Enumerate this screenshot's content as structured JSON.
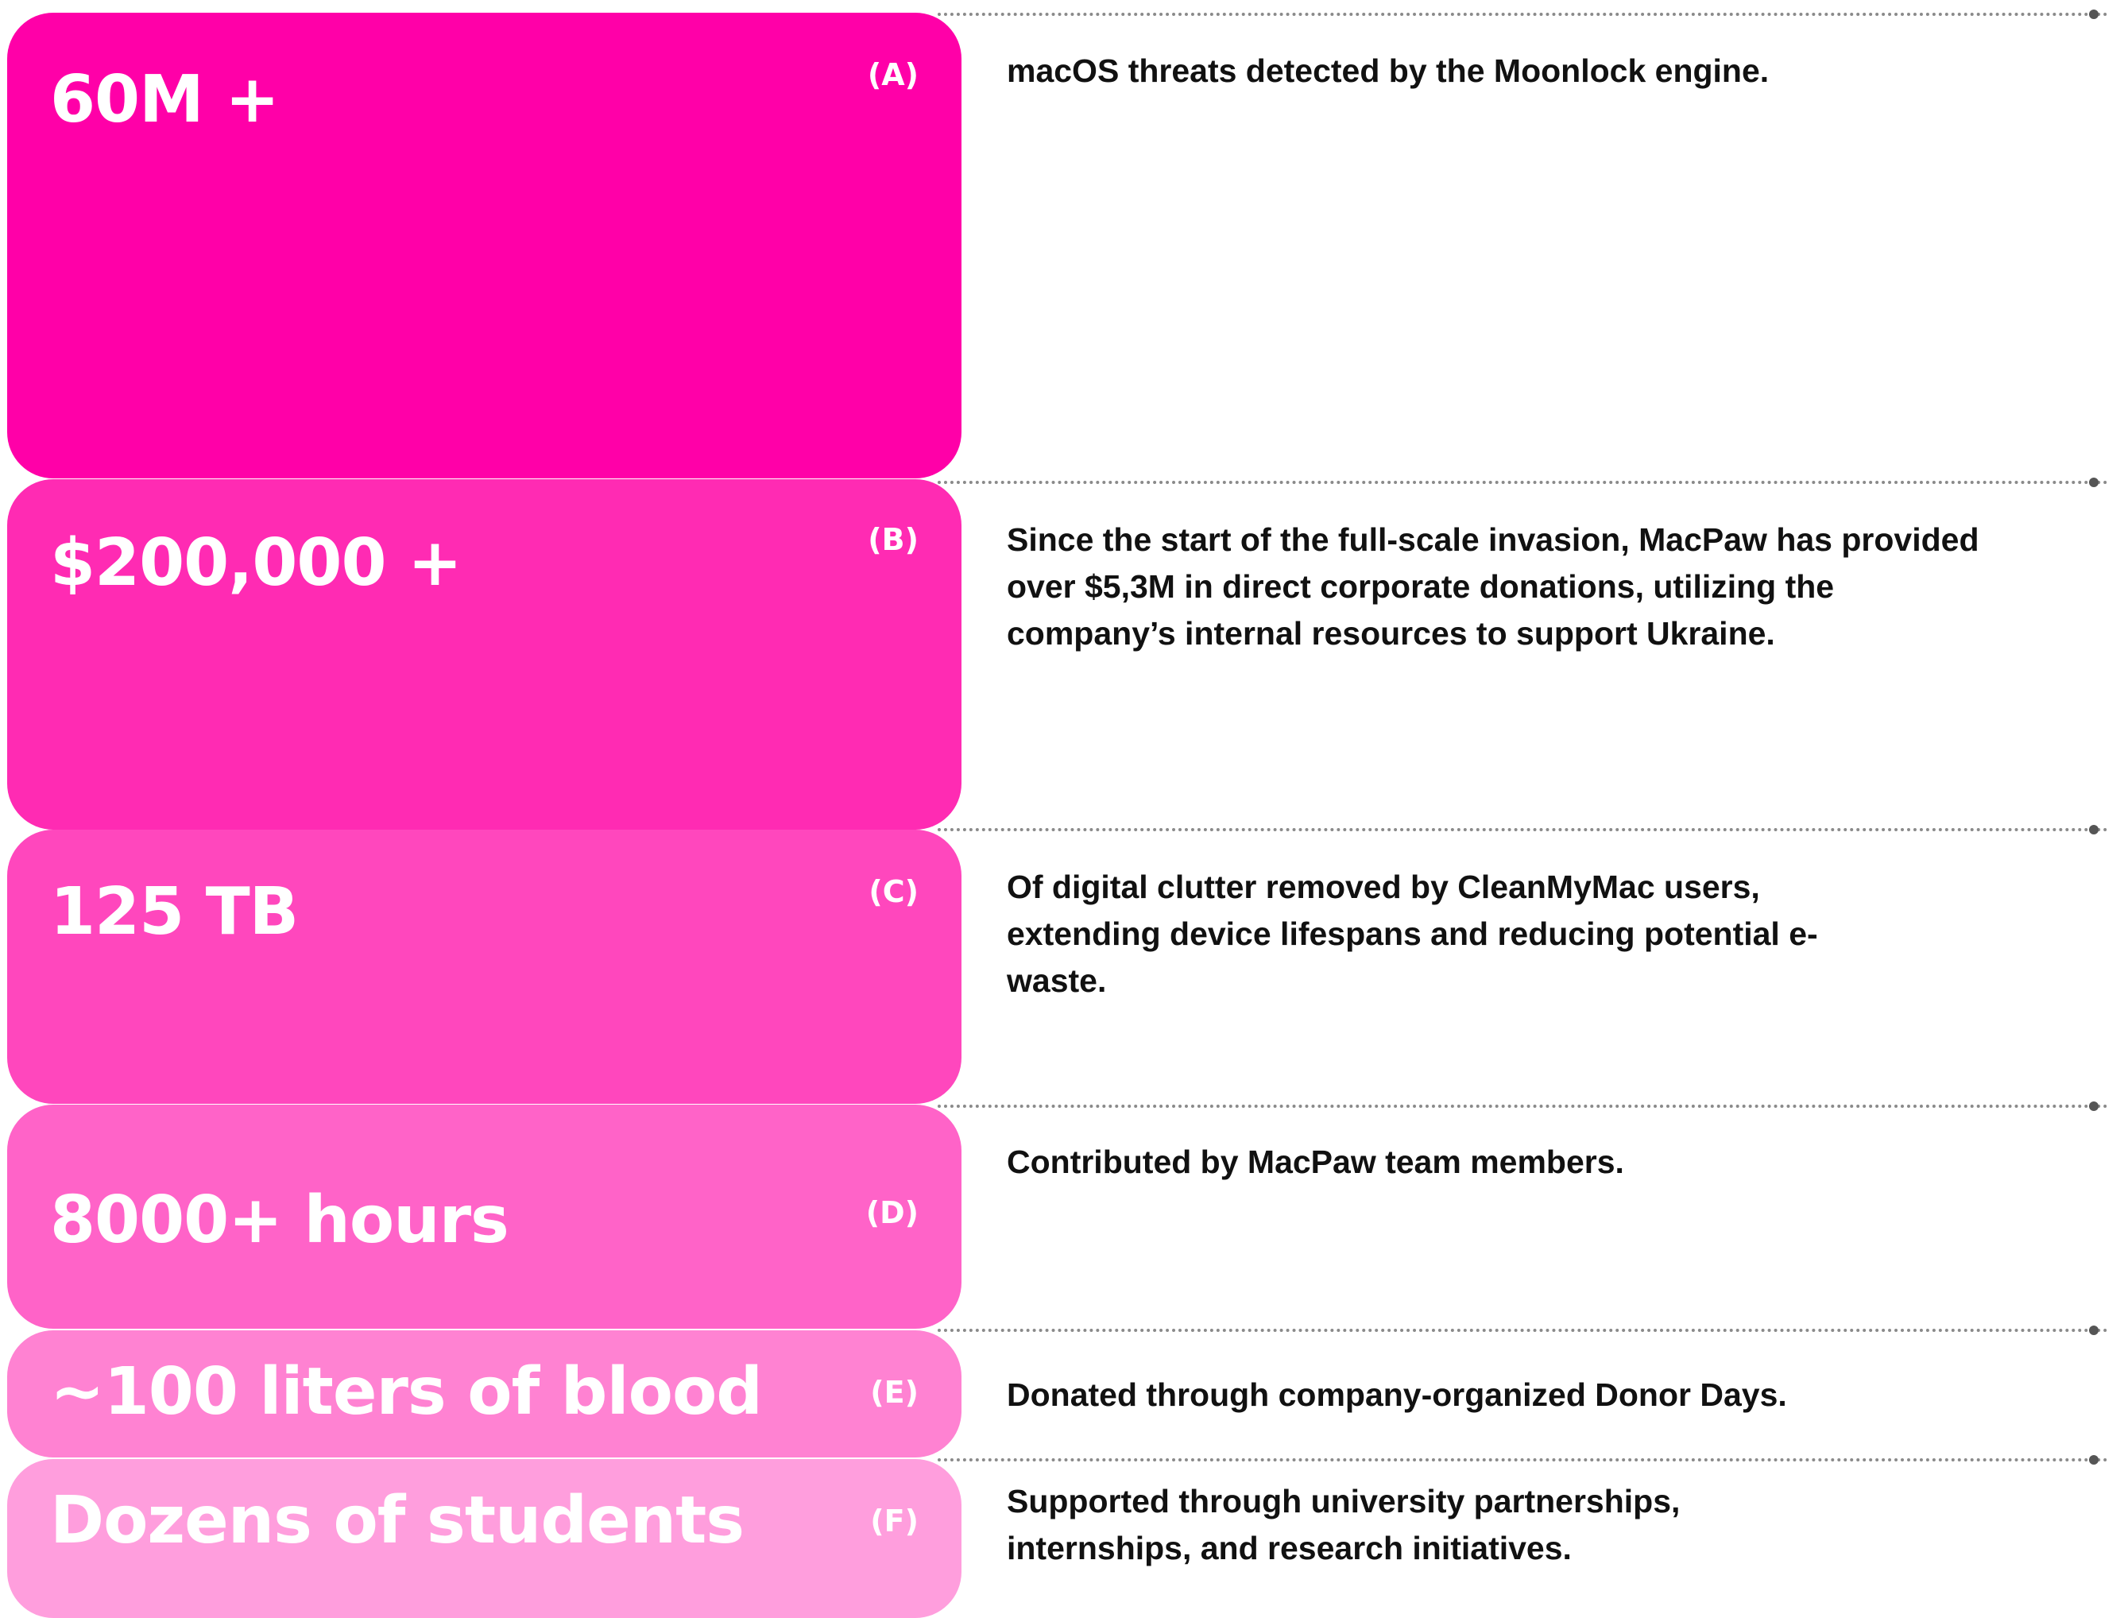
{
  "stats": [
    {
      "value": "60M +",
      "letter": "(A)",
      "description": "macOS threats detected by the Moonlock engine.",
      "color": "#ff00a8"
    },
    {
      "value": "$200,000 +",
      "letter": "(B)",
      "description": "Since the start of the full-scale invasion, MacPaw has provided over $5,3M in direct corporate donations, utilizing the company’s internal resources to support Ukraine.",
      "color": "#ff2bb3"
    },
    {
      "value": "125 TB",
      "letter": "(C)",
      "description": "Of digital clutter removed by CleanMyMac users, extending device lifespans and reducing potential e-waste.",
      "color": "#ff47bd"
    },
    {
      "value": "8000+ hours",
      "letter": "(D)",
      "description": "Contributed by MacPaw team members.",
      "color": "#ff63c8"
    },
    {
      "value": "~100 liters of blood",
      "letter": "(E)",
      "description": "Donated through company-organized Donor Days.",
      "color": "#ff82d2"
    },
    {
      "value": "Dozens of students",
      "letter": "(F)",
      "description": "Supported through university partnerships, internships, and research initiatives.",
      "color": "#ff9edd"
    }
  ]
}
